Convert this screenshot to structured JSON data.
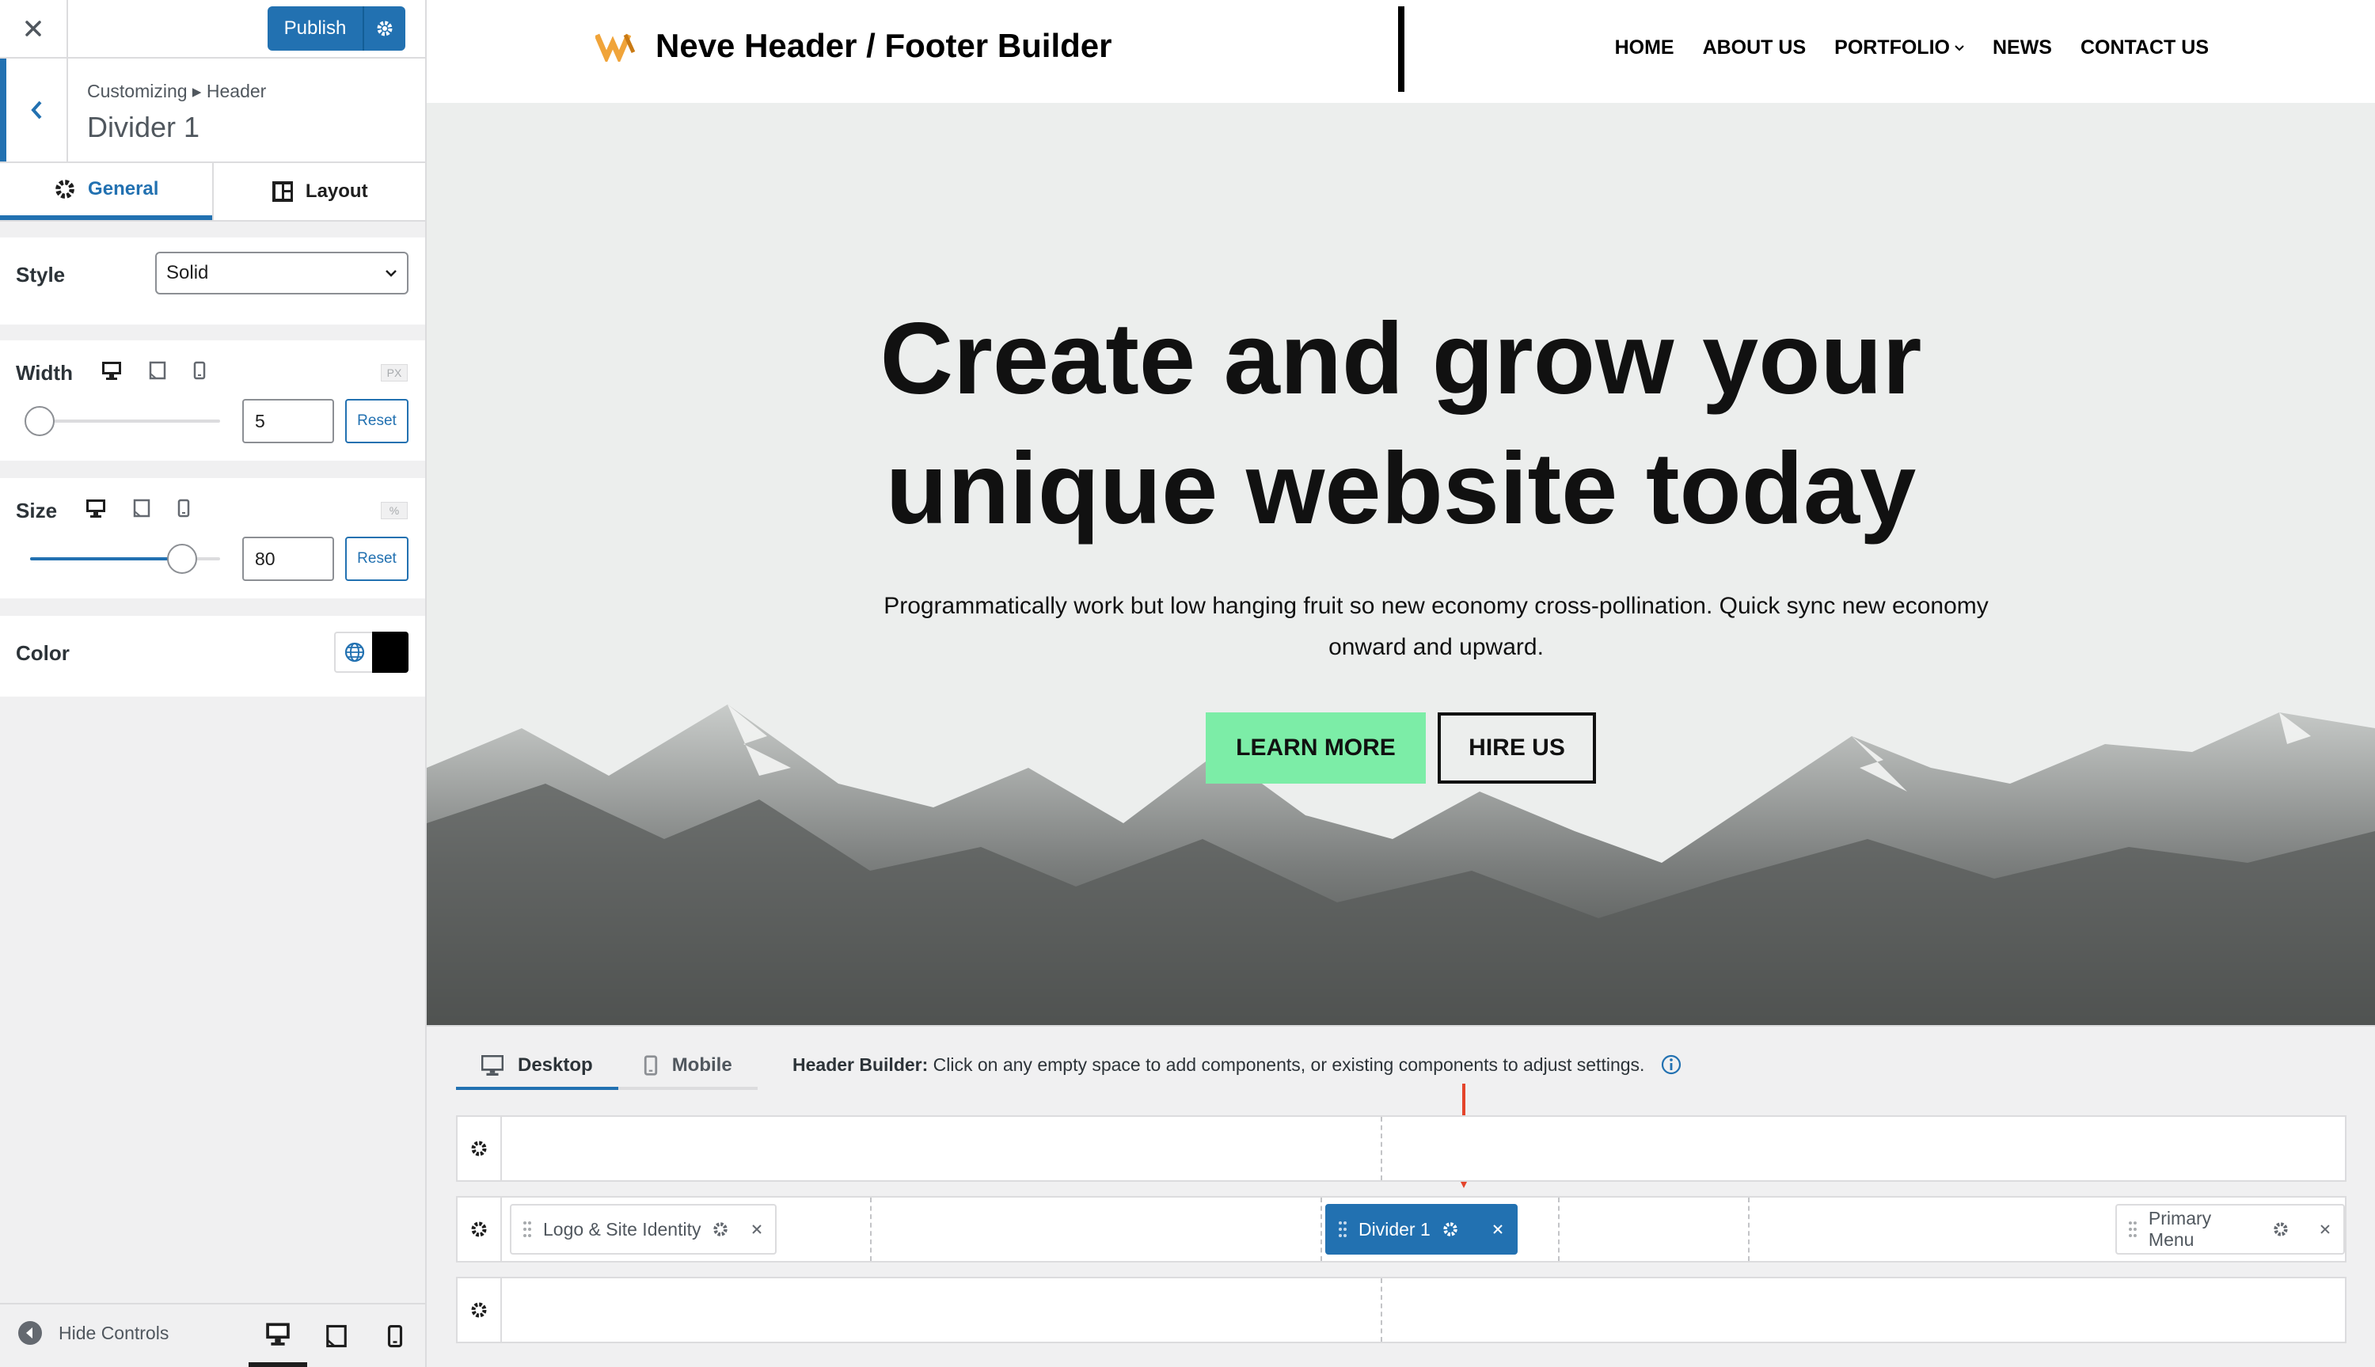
{
  "sidebar": {
    "publish_label": "Publish",
    "breadcrumb": "Customizing ▸ Header",
    "title": "Divider 1",
    "tabs": [
      {
        "label": "General",
        "icon": "gear-icon",
        "active": true
      },
      {
        "label": "Layout",
        "icon": "layout-icon",
        "active": false
      }
    ],
    "style": {
      "label": "Style",
      "value": "Solid"
    },
    "width": {
      "label": "Width",
      "unit": "PX",
      "value": "5",
      "reset": "Reset",
      "fraction": 0.05
    },
    "size": {
      "label": "Size",
      "unit": "%",
      "value": "80",
      "reset": "Reset",
      "fraction": 0.8
    },
    "color": {
      "label": "Color",
      "value": "#000000"
    },
    "hide_controls": "Hide Controls"
  },
  "site": {
    "title": "Neve Header / Footer Builder",
    "nav": [
      "HOME",
      "ABOUT US",
      "PORTFOLIO",
      "NEWS",
      "CONTACT US"
    ],
    "hero_title_line1": "Create and grow your",
    "hero_title_line2": "unique website today",
    "hero_sub": "Programmatically work but low hanging fruit so new economy cross-pollination. Quick sync new economy onward and upward.",
    "btn_learn": "LEARN MORE",
    "btn_hire": "HIRE US",
    "accent": "#7ceda7",
    "logo_color": "#f0a43a"
  },
  "builder": {
    "tabs": [
      {
        "label": "Desktop",
        "active": true
      },
      {
        "label": "Mobile",
        "active": false
      }
    ],
    "hint_bold": "Header Builder:",
    "hint_text": "Click on any empty space to add components, or existing components to adjust settings.",
    "components": {
      "logo": "Logo & Site Identity",
      "divider": "Divider 1",
      "menu": "Primary Menu"
    }
  },
  "colors": {
    "wp_blue": "#2271b1",
    "annotation_arrow": "#e4442b"
  }
}
